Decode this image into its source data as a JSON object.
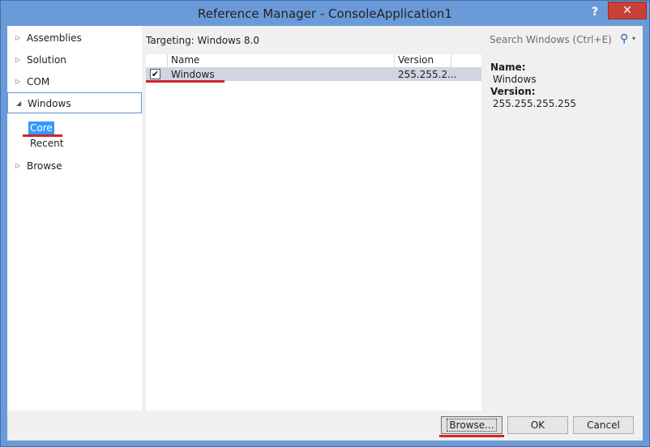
{
  "window": {
    "title": "Reference Manager - ConsoleApplication1",
    "help_label": "?",
    "close_label": "✕"
  },
  "sidebar": {
    "items": [
      {
        "label": "Assemblies",
        "arrow": "▷"
      },
      {
        "label": "Solution",
        "arrow": "▷"
      },
      {
        "label": "COM",
        "arrow": "▷"
      },
      {
        "label": "Windows",
        "arrow": "◢"
      },
      {
        "label": "Browse",
        "arrow": "▷"
      }
    ],
    "subitems": [
      {
        "label": "Core"
      },
      {
        "label": "Recent"
      }
    ]
  },
  "main": {
    "targeting": "Targeting: Windows 8.0",
    "columns": [
      "Name",
      "Version"
    ],
    "rows": [
      {
        "checked": "✔",
        "name": "Windows",
        "version": "255.255.2..."
      }
    ]
  },
  "search": {
    "placeholder": "Search Windows (Ctrl+E)",
    "icon": "⚲",
    "dropdown": "▾"
  },
  "details": {
    "name_label": "Name:",
    "name_value": "Windows",
    "version_label": "Version:",
    "version_value": "255.255.255.255"
  },
  "buttons": {
    "browse": "Browse...",
    "ok": "OK",
    "cancel": "Cancel"
  },
  "colors": {
    "accent": "#3399ff",
    "titlebar": "#6b9ad8",
    "highlight_line": "#d1252e",
    "close_button": "#c7413a"
  }
}
